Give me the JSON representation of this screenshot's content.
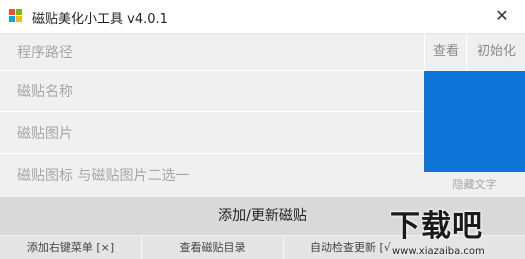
{
  "window": {
    "title": "磁贴美化小工具 v4.0.1",
    "close_glyph": "✕"
  },
  "fields": {
    "program_path": "程序路径",
    "tile_name": "磁贴名称",
    "tile_image": "磁贴图片",
    "tile_icon": "磁贴图标  与磁贴图片二选一"
  },
  "top_buttons": {
    "view": "查看",
    "initialize": "初始化"
  },
  "preview": {
    "tile_color": "#0b74d6",
    "hidden_text_label": "隐藏文字"
  },
  "main_button": "添加/更新磁贴",
  "bottom_buttons": {
    "context_menu": "添加右键菜单 [×]",
    "view_dir": "查看磁贴目录",
    "auto_update": "自动检查更新 [√"
  },
  "watermark": {
    "big": "下载吧",
    "small": "www.xiazaiba.com"
  }
}
